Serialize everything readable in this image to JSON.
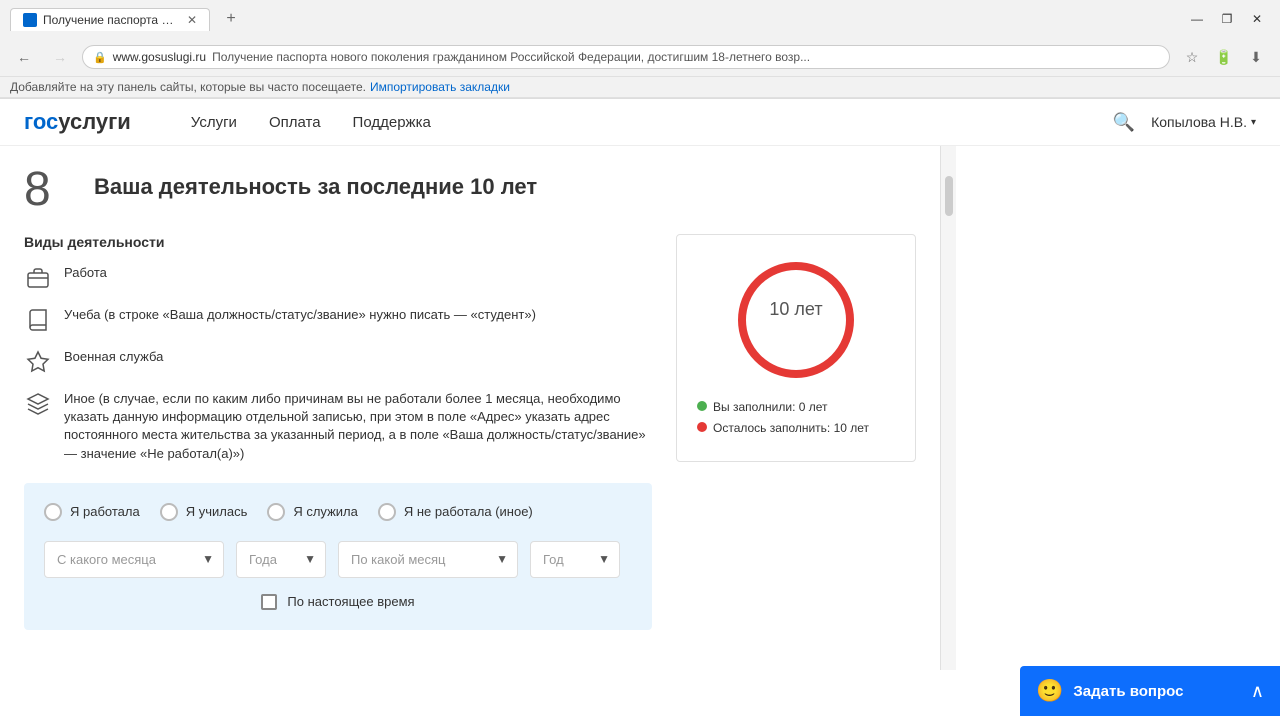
{
  "browser": {
    "tab_title": "Получение паспорта но...",
    "url_domain": "www.gosuslugi.ru",
    "url_title": "Получение паспорта нового поколения гражданином Российской Федерации, достигшим 18-летнего возр...",
    "new_tab_label": "+",
    "window_controls": [
      "—",
      "❐",
      "✕"
    ],
    "bookmarks_text": "Добавляйте на эту панель сайты, которые вы часто посещаете.",
    "bookmarks_link": "Импортировать закладки"
  },
  "header": {
    "logo_gos": "гос",
    "logo_uslugi": "услуги",
    "nav": [
      "Услуги",
      "Оплата",
      "Поддержка"
    ],
    "user": "Копылова Н.В.",
    "user_chevron": "▾"
  },
  "step": {
    "number": "8",
    "title": "Ваша деятельность за последние 10 лет"
  },
  "activities": {
    "title": "Виды деятельности",
    "items": [
      {
        "icon": "briefcase",
        "text": "Работа"
      },
      {
        "icon": "book",
        "text": "Учеба (в строке «Ваша должность/статус/звание» нужно писать — «студент»)"
      },
      {
        "icon": "star",
        "text": "Военная служба"
      },
      {
        "icon": "layers",
        "text": "Иное (в случае, если по каким либо причинам вы не работали более 1 месяца, необходимо указать данную информацию отдельной записью, при этом в поле «Адрес» указать адрес постоянного места жительства за указанный период, а в поле «Ваша должность/статус/звание» — значение «Не работал(а)»)"
      }
    ]
  },
  "progress": {
    "center_text": "10 лет",
    "legend": [
      {
        "color": "green",
        "text": "Вы заполнили: 0 лет"
      },
      {
        "color": "red",
        "text": "Осталось заполнить: 10 лет"
      }
    ],
    "total_years": 10,
    "filled_years": 0
  },
  "form": {
    "radio_options": [
      "Я работала",
      "Я училась",
      "Я служила",
      "Я не работала (иное)"
    ],
    "date_fields": [
      {
        "placeholder": "С какого месяца",
        "size": "wide"
      },
      {
        "placeholder": "Года",
        "size": "small"
      },
      {
        "placeholder": "По какой месяц",
        "size": "wide"
      },
      {
        "placeholder": "Год",
        "size": "small"
      }
    ],
    "checkbox_label": "По настоящее время"
  },
  "ask_button": {
    "icon": "🙂",
    "label": "Задать вопрос",
    "chevron": "∧"
  }
}
